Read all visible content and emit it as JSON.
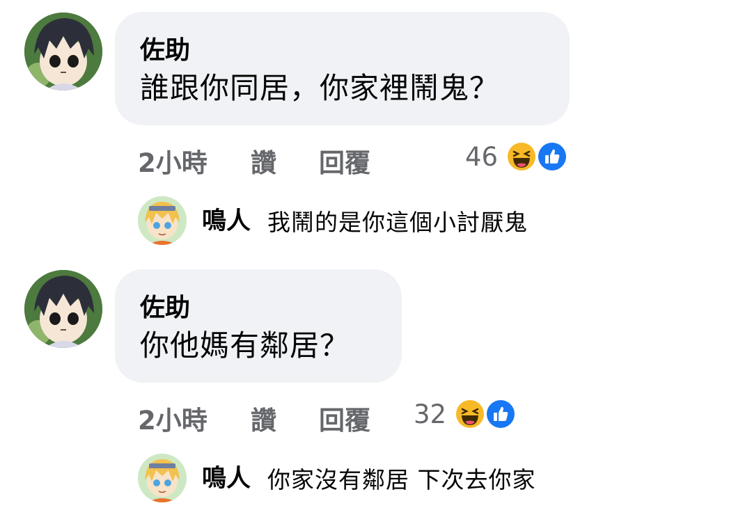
{
  "threads": [
    {
      "author": "佐助",
      "text": "誰跟你同居，你家裡鬧鬼？",
      "time": "2小時",
      "like_label": "讚",
      "reply_label": "回覆",
      "reaction_count": "46",
      "reactions": [
        "haha-icon",
        "like-icon"
      ],
      "reply": {
        "author": "鳴人",
        "text": "我鬧的是你這個小討厭鬼"
      }
    },
    {
      "author": "佐助",
      "text": "你他媽有鄰居？",
      "time": "2小時",
      "like_label": "讚",
      "reply_label": "回覆",
      "reaction_count": "32",
      "reactions": [
        "haha-icon",
        "like-icon"
      ],
      "reply": {
        "author": "鳴人",
        "text": "你家沒有鄰居 下次去你家"
      }
    }
  ],
  "colors": {
    "bubble": "#f0f2f5",
    "meta_text": "#65676b",
    "like_blue": "#1877f2",
    "haha_yellow": "#f7b928"
  }
}
